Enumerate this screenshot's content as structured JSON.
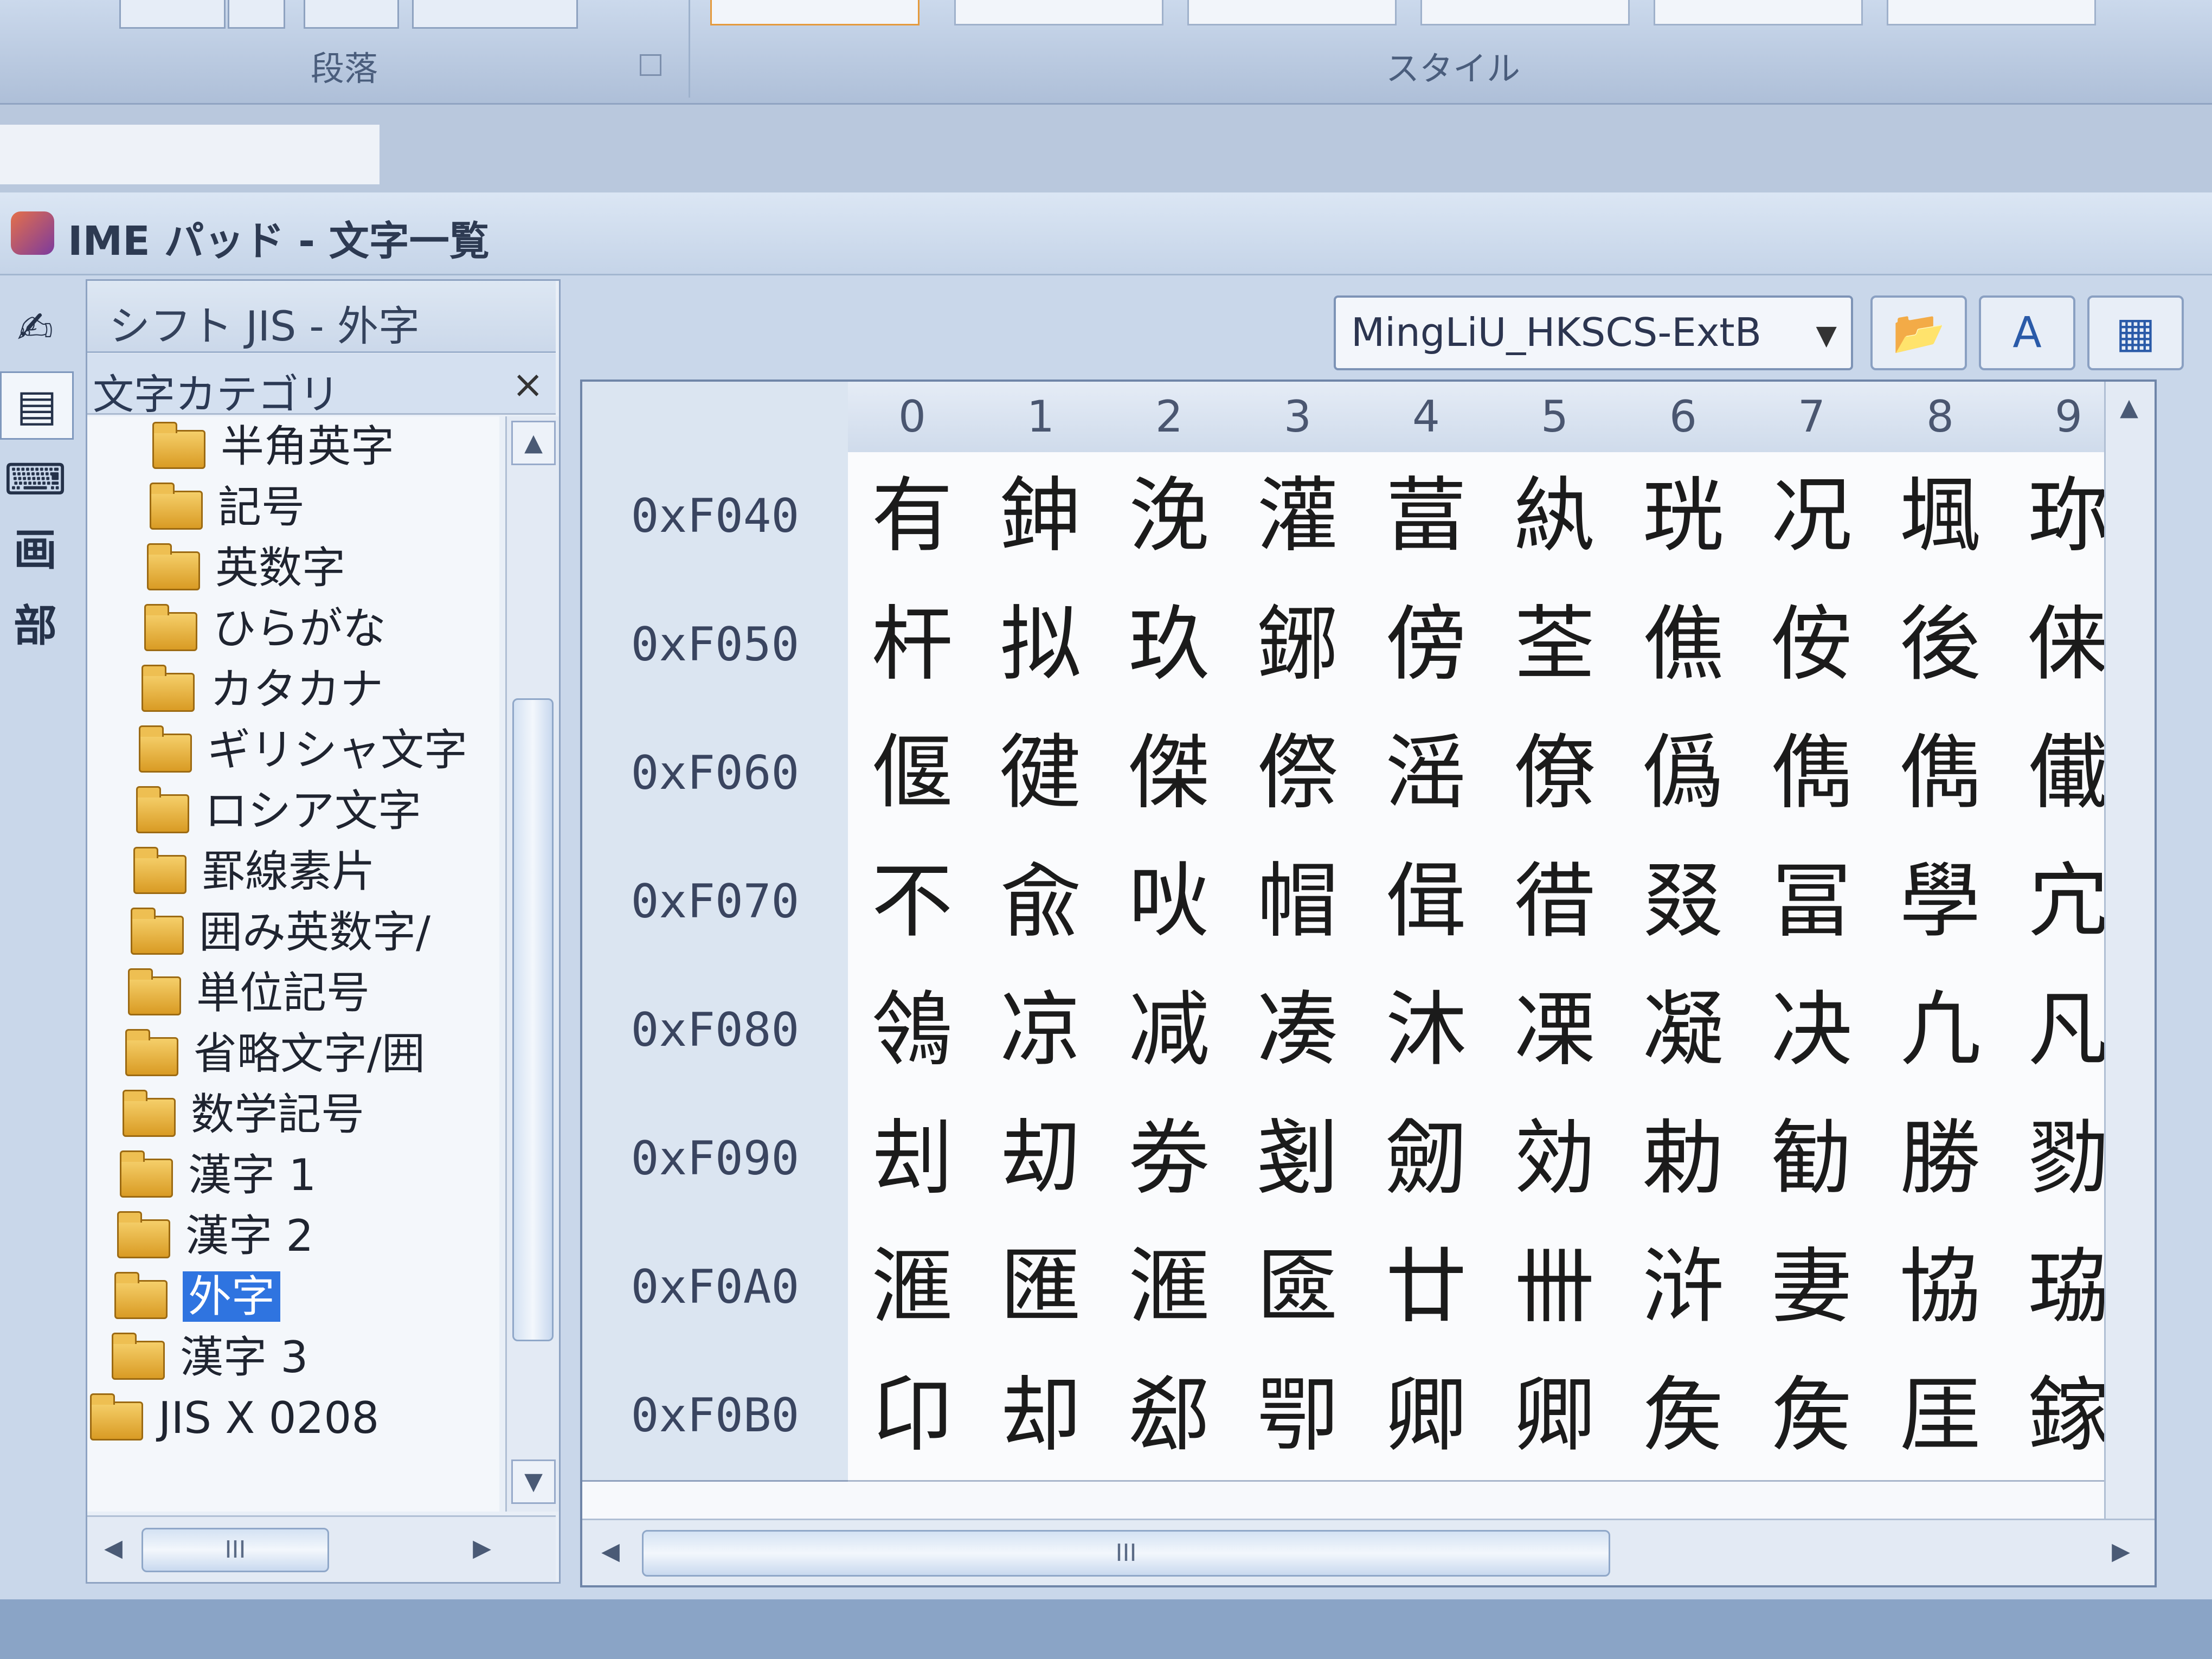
{
  "ribbon": {
    "paragraph_label": "段落",
    "styles_label": "スタイル"
  },
  "window": {
    "title": "IME パッド - 文字一覧"
  },
  "tools": [
    "画",
    "部"
  ],
  "panel": {
    "header": "シフト JIS - 外字",
    "category_title": "文字カテゴリ",
    "close_glyph": "×",
    "items": [
      {
        "label": "半角英字"
      },
      {
        "label": "記号"
      },
      {
        "label": "英数字"
      },
      {
        "label": "ひらがな"
      },
      {
        "label": "カタカナ"
      },
      {
        "label": "ギリシャ文字"
      },
      {
        "label": "ロシア文字"
      },
      {
        "label": "罫線素片"
      },
      {
        "label": "囲み英数字/"
      },
      {
        "label": "単位記号"
      },
      {
        "label": "省略文字/囲"
      },
      {
        "label": "数学記号"
      },
      {
        "label": "漢字 1"
      },
      {
        "label": "漢字 2"
      },
      {
        "label": "外字",
        "selected": true
      },
      {
        "label": "漢字 3"
      },
      {
        "label": "JIS X 0208"
      }
    ]
  },
  "toolbar": {
    "font_name": "MingLiU_HKSCS-ExtB"
  },
  "grid": {
    "columns": [
      "0",
      "1",
      "2",
      "3",
      "4",
      "5",
      "6",
      "7",
      "8",
      "9"
    ],
    "rows": [
      {
        "code": "0xF040",
        "chars": [
          "有",
          "鉮",
          "浼",
          "灌",
          "葍",
          "紈",
          "珖",
          "况",
          "堸",
          "珎"
        ]
      },
      {
        "code": "0xF050",
        "chars": [
          "杆",
          "拟",
          "玖",
          "鋣",
          "傍",
          "荃",
          "僬",
          "侒",
          "後",
          "俫"
        ]
      },
      {
        "code": "0xF060",
        "chars": [
          "偃",
          "徤",
          "傑",
          "傺",
          "滛",
          "僚",
          "僞",
          "儁",
          "儁",
          "儎"
        ]
      },
      {
        "code": "0xF070",
        "chars": [
          "不",
          "兪",
          "吙",
          "帽",
          "偮",
          "徣",
          "叕",
          "冨",
          "學",
          "宂"
        ]
      },
      {
        "code": "0xF080",
        "chars": [
          "鴒",
          "凉",
          "减",
          "凑",
          "沐",
          "凓",
          "凝",
          "决",
          "凢",
          "凡"
        ]
      },
      {
        "code": "0xF090",
        "chars": [
          "刦",
          "刧",
          "劵",
          "剗",
          "劒",
          "効",
          "勅",
          "勧",
          "勝",
          "勠"
        ]
      },
      {
        "code": "0xF0A0",
        "chars": [
          "滙",
          "匯",
          "滙",
          "匳",
          "廿",
          "卌",
          "浒",
          "妻",
          "協",
          "珕"
        ]
      },
      {
        "code": "0xF0B0",
        "chars": [
          "卬",
          "却",
          "郄",
          "卾",
          "卿",
          "卿",
          "矦",
          "矦",
          "厓",
          "鎵"
        ]
      }
    ]
  },
  "scroll": {
    "grip": "III",
    "up": "▲",
    "down": "▼",
    "left": "◀",
    "right": "▶"
  }
}
